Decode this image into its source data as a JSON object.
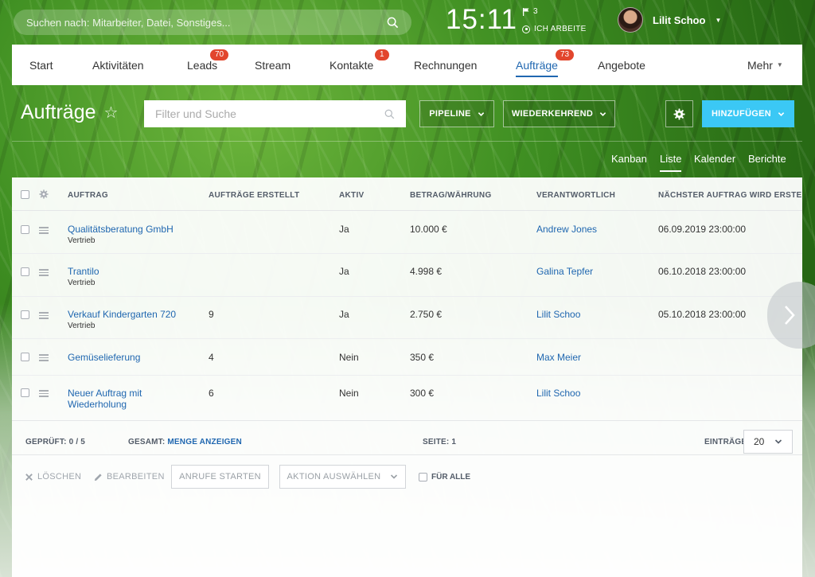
{
  "top": {
    "search_placeholder": "Suchen nach: Mitarbeiter, Datei, Sonstiges...",
    "clock": "15:11",
    "flag_count": "3",
    "work_status": "ICH ARBEITE",
    "user_name": "Lilit Schoo"
  },
  "nav": {
    "items": [
      {
        "label": "Start"
      },
      {
        "label": "Aktivitäten"
      },
      {
        "label": "Leads",
        "badge": "70"
      },
      {
        "label": "Stream"
      },
      {
        "label": "Kontakte",
        "badge": "1"
      },
      {
        "label": "Rechnungen"
      },
      {
        "label": "Aufträge",
        "badge": "73",
        "active": true
      },
      {
        "label": "Angebote"
      }
    ],
    "more": "Mehr"
  },
  "toolbar": {
    "title": "Aufträge",
    "filter_placeholder": "Filter und Suche",
    "pipeline": "PIPELINE",
    "recurring": "WIEDERKEHREND",
    "add": "HINZUFÜGEN"
  },
  "view_tabs": [
    "Kanban",
    "Liste",
    "Kalender",
    "Berichte"
  ],
  "active_view": "Liste",
  "table": {
    "columns": [
      "AUFTRAG",
      "AUFTRÄGE ERSTELLT",
      "AKTIV",
      "BETRAG/WÄHRUNG",
      "VERANTWORTLICH",
      "NÄCHSTER AUFTRAG WIRD ERSTELLT"
    ],
    "rows": [
      {
        "title": "Qualitätsberatung GmbH",
        "sub": "Vertrieb",
        "created": "",
        "active": "Ja",
        "amount": "10.000 €",
        "owner": "Andrew Jones",
        "next": "06.09.2019 23:00:00"
      },
      {
        "title": "Trantilo",
        "sub": "Vertrieb",
        "created": "",
        "active": "Ja",
        "amount": "4.998 €",
        "owner": "Galina Tepfer",
        "next": "06.10.2018 23:00:00"
      },
      {
        "title": "Verkauf Kindergarten 720",
        "sub": "Vertrieb",
        "created": "9",
        "active": "Ja",
        "amount": "2.750 €",
        "owner": "Lilit Schoo",
        "next": "05.10.2018 23:00:00"
      },
      {
        "title": "Gemüselieferung",
        "sub": "",
        "created": "4",
        "active": "Nein",
        "amount": "350 €",
        "owner": "Max Meier",
        "next": ""
      },
      {
        "title": "Neuer Auftrag mit Wiederholung",
        "sub": "",
        "created": "6",
        "active": "Nein",
        "amount": "300 €",
        "owner": "Lilit Schoo",
        "next": ""
      }
    ]
  },
  "footer": {
    "checked_label": "GEPRÜFT:",
    "checked_value": "0 / 5",
    "total_label": "GESAMT:",
    "total_link": "MENGE ANZEIGEN",
    "page_label": "SEITE:",
    "page_value": "1",
    "entries_label": "EINTRÄGE",
    "entries_value": "20"
  },
  "actions": {
    "delete": "LÖSCHEN",
    "edit": "BEARBEITEN",
    "start_calls": "ANRUFE STARTEN",
    "select_action": "AKTION AUSWÄHLEN",
    "for_all": "FÜR ALLE"
  },
  "colors": {
    "accent": "#2067b0",
    "add_button": "#3bc8f5",
    "badge": "#e2462d"
  }
}
